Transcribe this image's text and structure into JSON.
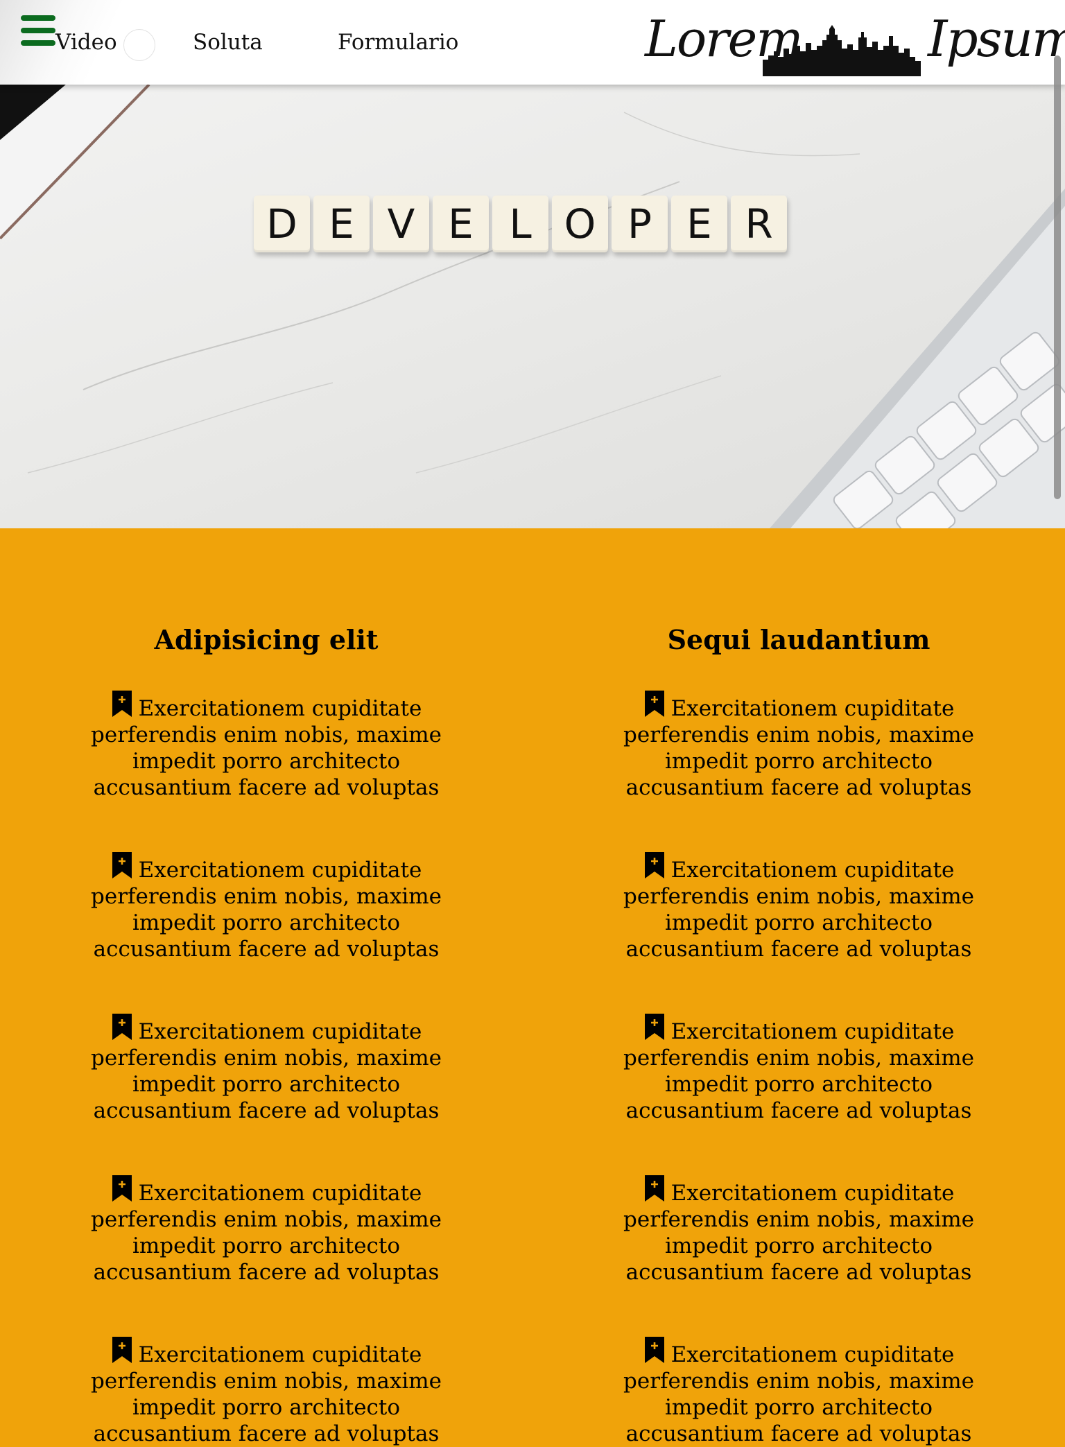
{
  "nav": {
    "links": [
      "Video",
      "Soluta",
      "Formulario"
    ]
  },
  "logo": {
    "word_left": "Lorem",
    "word_right": "Ipsum"
  },
  "hero": {
    "tiles": [
      "D",
      "E",
      "V",
      "E",
      "L",
      "O",
      "P",
      "E",
      "R"
    ]
  },
  "columns": [
    {
      "title": "Adipisicing elit",
      "items": [
        "Exercitationem cupiditate perferendis enim nobis, maxime impedit porro architecto accusantium facere ad voluptas",
        "Exercitationem cupiditate perferendis enim nobis, maxime impedit porro architecto accusantium facere ad voluptas",
        "Exercitationem cupiditate perferendis enim nobis, maxime impedit porro architecto accusantium facere ad voluptas",
        "Exercitationem cupiditate perferendis enim nobis, maxime impedit porro architecto accusantium facere ad voluptas",
        "Exercitationem cupiditate perferendis enim nobis, maxime impedit porro architecto accusantium facere ad voluptas"
      ]
    },
    {
      "title": "Sequi laudantium",
      "items": [
        "Exercitationem cupiditate perferendis enim nobis, maxime impedit porro architecto accusantium facere ad voluptas",
        "Exercitationem cupiditate perferendis enim nobis, maxime impedit porro architecto accusantium facere ad voluptas",
        "Exercitationem cupiditate perferendis enim nobis, maxime impedit porro architecto accusantium facere ad voluptas",
        "Exercitationem cupiditate perferendis enim nobis, maxime impedit porro architecto accusantium facere ad voluptas",
        "Exercitationem cupiditate perferendis enim nobis, maxime impedit porro architecto accusantium facere ad voluptas"
      ]
    }
  ],
  "icons": {
    "menu": "hamburger-menu-icon",
    "bookmark": "bookmark-plus-icon"
  },
  "colors": {
    "page_background": "#f0a30a",
    "header_background": "#ffffff",
    "menu_icon": "#0b6b1f",
    "text": "#000000"
  }
}
